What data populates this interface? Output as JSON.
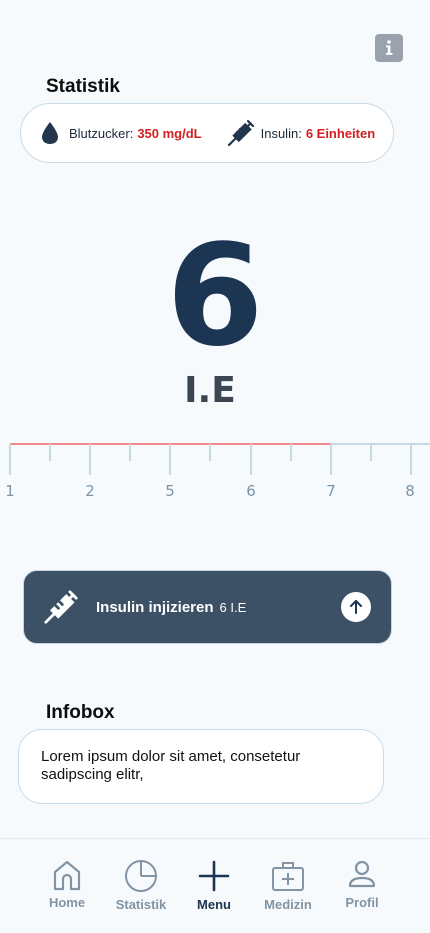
{
  "header": {
    "info_icon": "info-icon"
  },
  "stats": {
    "title": "Statistik",
    "blood_sugar": {
      "label": "Blutzucker:",
      "value": "350 mg/dL",
      "icon": "blood-drop-icon"
    },
    "insulin": {
      "label": "Insulin:",
      "value": "6 Einheiten",
      "icon": "syringe-icon"
    }
  },
  "dose": {
    "value": "6",
    "unit": "I.E"
  },
  "ruler": {
    "labels": [
      "1",
      "2",
      "5",
      "6",
      "7",
      "8"
    ],
    "active_color": "#f08a86",
    "inactive_color": "#c6d8e4"
  },
  "inject_button": {
    "label": "Insulin injizieren",
    "dose": "6 I.E",
    "icon": "syringe-icon",
    "action_icon": "arrow-up-icon"
  },
  "infobox": {
    "title": "Infobox",
    "text": "Lorem ipsum dolor sit amet, consetetur sadipscing elitr,"
  },
  "nav": {
    "items": [
      {
        "label": "Home",
        "icon": "home-icon"
      },
      {
        "label": "Statistik",
        "icon": "pie-chart-icon"
      },
      {
        "label": "Menu",
        "icon": "plus-icon",
        "active": true
      },
      {
        "label": "Medizin",
        "icon": "medical-case-icon"
      },
      {
        "label": "Profil",
        "icon": "profile-icon"
      }
    ]
  },
  "colors": {
    "accent": "#1b3552",
    "button": "#3d5166",
    "alert": "#d21f1f",
    "background": "#f7fafd"
  }
}
